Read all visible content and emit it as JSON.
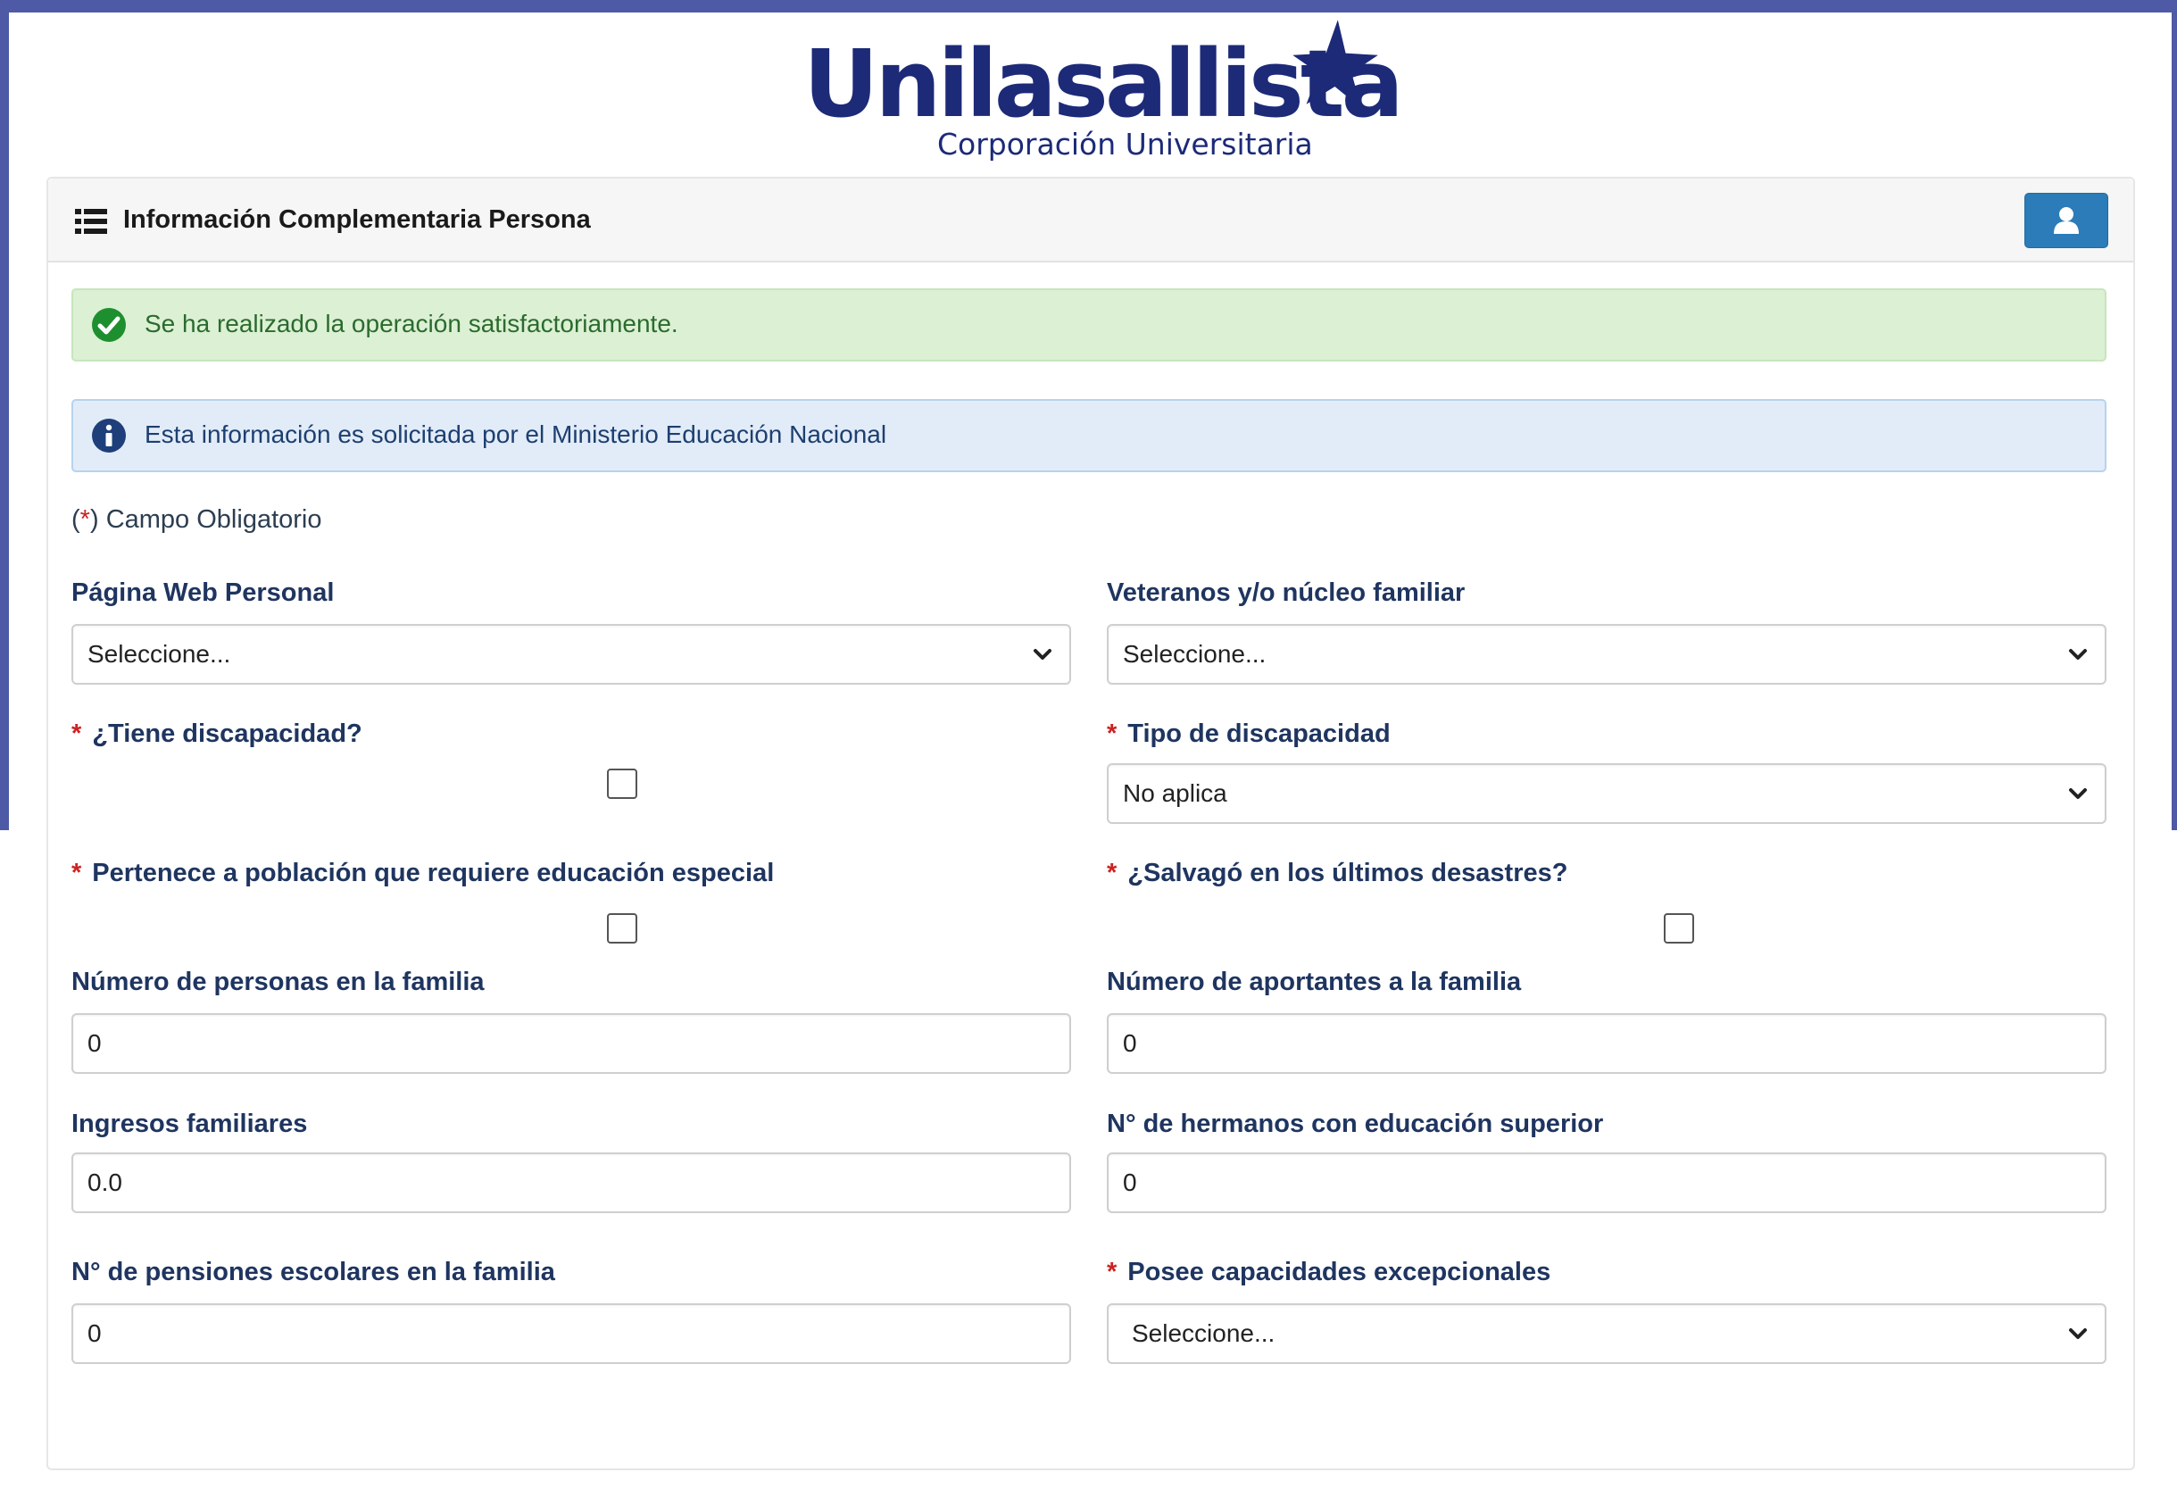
{
  "brand": {
    "name": "Unilasallista",
    "subtitle": "Corporación Universitaria",
    "color": "#1c2a78"
  },
  "panel": {
    "title": "Información Complementaria Persona",
    "title_icon": "list-icon",
    "user_button_icon": "user-icon",
    "accent": "#2b7cb8"
  },
  "alerts": {
    "success": "Se ha realizado la operación satisfactoriamente.",
    "info": "Esta información es solicitada por el Ministerio Educación Nacional"
  },
  "legend": {
    "open": "(",
    "mark": "*",
    "close": ")",
    "text": "Campo Obligatorio"
  },
  "required_mark": "*",
  "fields": {
    "pagina_web": {
      "label": "Página Web Personal",
      "value": "Seleccione..."
    },
    "veteranos": {
      "label": "Veteranos y/o núcleo familiar",
      "value": "Seleccione..."
    },
    "discapacidad": {
      "label": "¿Tiene discapacidad?",
      "checked": false
    },
    "tipo_discapacidad": {
      "label": "Tipo de discapacidad",
      "value": "No aplica"
    },
    "educacion_especial": {
      "label": "Pertenece a población que requiere educación especial",
      "checked": false
    },
    "desastres": {
      "label": "¿Salvagó en los últimos desastres?",
      "checked": false
    },
    "personas_familia": {
      "label": "Número de personas en la familia",
      "value": "0"
    },
    "aportantes": {
      "label": "Número de aportantes a la familia",
      "value": "0"
    },
    "ingresos": {
      "label": "Ingresos familiares",
      "value": "0.0"
    },
    "hermanos": {
      "label": "N° de hermanos con educación superior",
      "value": "0"
    },
    "pensiones": {
      "label": "N° de pensiones escolares en la familia",
      "value": "0"
    },
    "capacidades": {
      "label": "Posee capacidades excepcionales",
      "value": "Seleccione..."
    }
  }
}
